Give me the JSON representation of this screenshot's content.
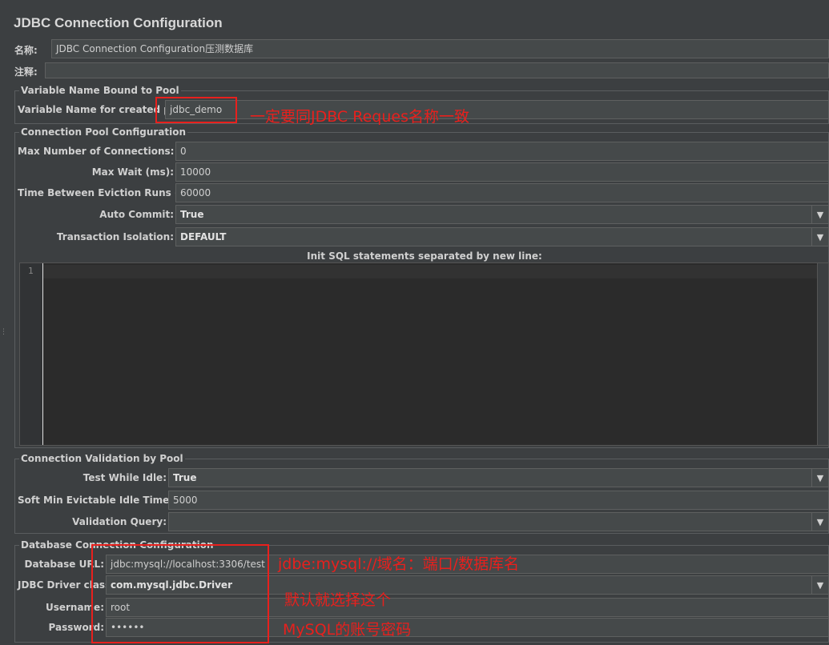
{
  "panel_title": "JDBC Connection Configuration",
  "name_label": "名称:",
  "name_value": "JDBC Connection Configuration压测数据库",
  "comment_label": "注释:",
  "comment_value": "",
  "variable_group": {
    "title": "Variable Name Bound to Pool",
    "label": "Variable Name for created pool:",
    "value": "jdbc_demo"
  },
  "pool_group": {
    "title": "Connection Pool Configuration",
    "max_connections_label": "Max Number of Connections:",
    "max_connections_value": "0",
    "max_wait_label": "Max Wait (ms):",
    "max_wait_value": "10000",
    "eviction_label": "Time Between Eviction Runs (ms):",
    "eviction_value": "60000",
    "auto_commit_label": "Auto Commit:",
    "auto_commit_value": "True",
    "isolation_label": "Transaction Isolation:",
    "isolation_value": "DEFAULT",
    "init_sql_label": "Init SQL statements separated by new line:",
    "line_number": "1"
  },
  "validation_group": {
    "title": "Connection Validation by Pool",
    "test_idle_label": "Test While Idle:",
    "test_idle_value": "True",
    "soft_min_label": "Soft Min Evictable Idle Time(ms):",
    "soft_min_value": "5000",
    "query_label": "Validation Query:",
    "query_value": ""
  },
  "database_group": {
    "title": "Database Connection Configuration",
    "url_label": "Database URL:",
    "url_value": "jdbc:mysql://localhost:3306/test",
    "driver_label": "JDBC Driver class:",
    "driver_value": "com.mysql.jdbc.Driver",
    "username_label": "Username:",
    "username_value": "root",
    "password_label": "Password:",
    "password_value": "••••••"
  },
  "annotations": {
    "variable_note": "一定要同JDBC Reques名称一致",
    "url_note": "jdbe:mysql://域名：端口/数据库名",
    "driver_note": "默认就选择这个",
    "account_note": "MySQL的账号密码"
  },
  "colors": {
    "background": "#3c3f41",
    "annotation_red": "#e8201d"
  }
}
